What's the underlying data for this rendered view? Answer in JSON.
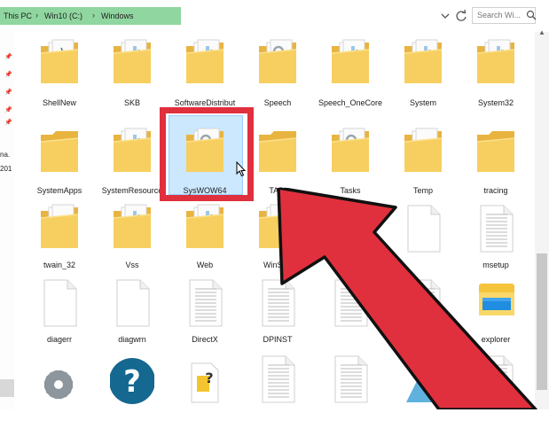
{
  "addressbar": {
    "crumbs": [
      "This PC",
      "Win10 (C:)",
      "Windows"
    ],
    "search_placeholder": "Search Wi..."
  },
  "leftpane": {
    "fragments": [
      "na.",
      "201"
    ]
  },
  "items": [
    {
      "label": "ShellNew",
      "type": "folder-quill"
    },
    {
      "label": "SKB",
      "type": "folder-docs"
    },
    {
      "label": "SoftwareDistribut",
      "type": "folder-docs"
    },
    {
      "label": "Speech",
      "type": "folder-gears"
    },
    {
      "label": "Speech_OneCore",
      "type": "folder-docs"
    },
    {
      "label": "System",
      "type": "folder-docs"
    },
    {
      "label": "System32",
      "type": "folder-docs"
    },
    {
      "label": "SystemApps",
      "type": "folder"
    },
    {
      "label": "SystemResource",
      "type": "folder-docs"
    },
    {
      "label": "SysWOW64",
      "type": "folder-gears"
    },
    {
      "label": "TAPI",
      "type": "folder"
    },
    {
      "label": "Tasks",
      "type": "folder-gears"
    },
    {
      "label": "Temp",
      "type": "folder-white"
    },
    {
      "label": "tracing",
      "type": "folder"
    },
    {
      "label": "twain_32",
      "type": "folder-white"
    },
    {
      "label": "Vss",
      "type": "folder-docs"
    },
    {
      "label": "Web",
      "type": "folder-docs"
    },
    {
      "label": "WinSxS",
      "type": "folder-docs"
    },
    {
      "label": "",
      "type": "window"
    },
    {
      "label": "",
      "type": "file"
    },
    {
      "label": "msetup",
      "type": "doc"
    },
    {
      "label": "diagerr",
      "type": "file"
    },
    {
      "label": "diagwrn",
      "type": "file"
    },
    {
      "label": "DirectX",
      "type": "doc"
    },
    {
      "label": "DPINST",
      "type": "doc"
    },
    {
      "label": "",
      "type": "doc"
    },
    {
      "label": "",
      "type": "doc"
    },
    {
      "label": "explorer",
      "type": "explorer"
    },
    {
      "label": "",
      "type": "gear"
    },
    {
      "label": "",
      "type": "help"
    },
    {
      "label": "",
      "type": "inf"
    },
    {
      "label": "",
      "type": "doc"
    },
    {
      "label": "",
      "type": "doc"
    },
    {
      "label": "",
      "type": "app"
    },
    {
      "label": "",
      "type": "doc"
    }
  ],
  "colors": {
    "folder": "#f7cf60",
    "folder_dark": "#e8b43f",
    "highlight_red": "#e0303d",
    "selection": "#cce8ff",
    "breadcrumb_bg": "#8fd6a0"
  }
}
